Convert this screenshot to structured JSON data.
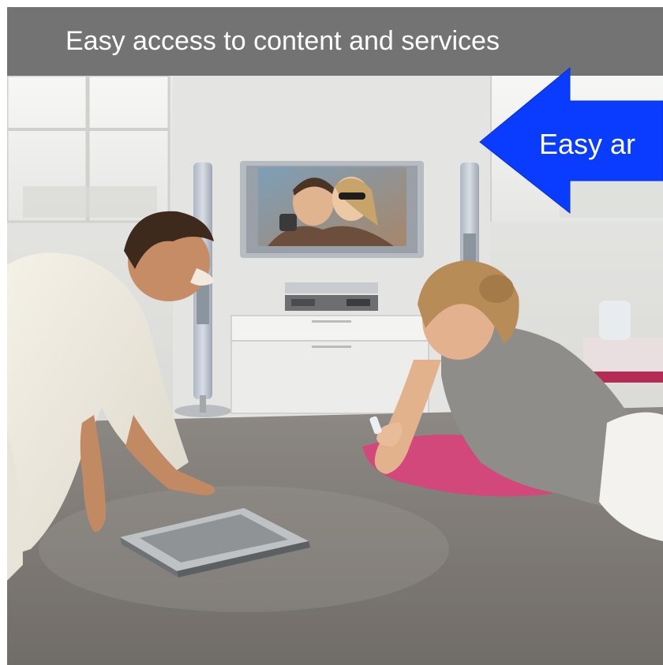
{
  "slide": {
    "title": "Easy access to content and services",
    "callout_text": "Easy ar"
  },
  "colors": {
    "title_bar_bg": "#737373",
    "title_text": "#ffffff",
    "arrow_fill": "#0a3cff",
    "arrow_text": "#ffffff"
  },
  "photo": {
    "scene": "living-room-couple-watching-tv"
  }
}
